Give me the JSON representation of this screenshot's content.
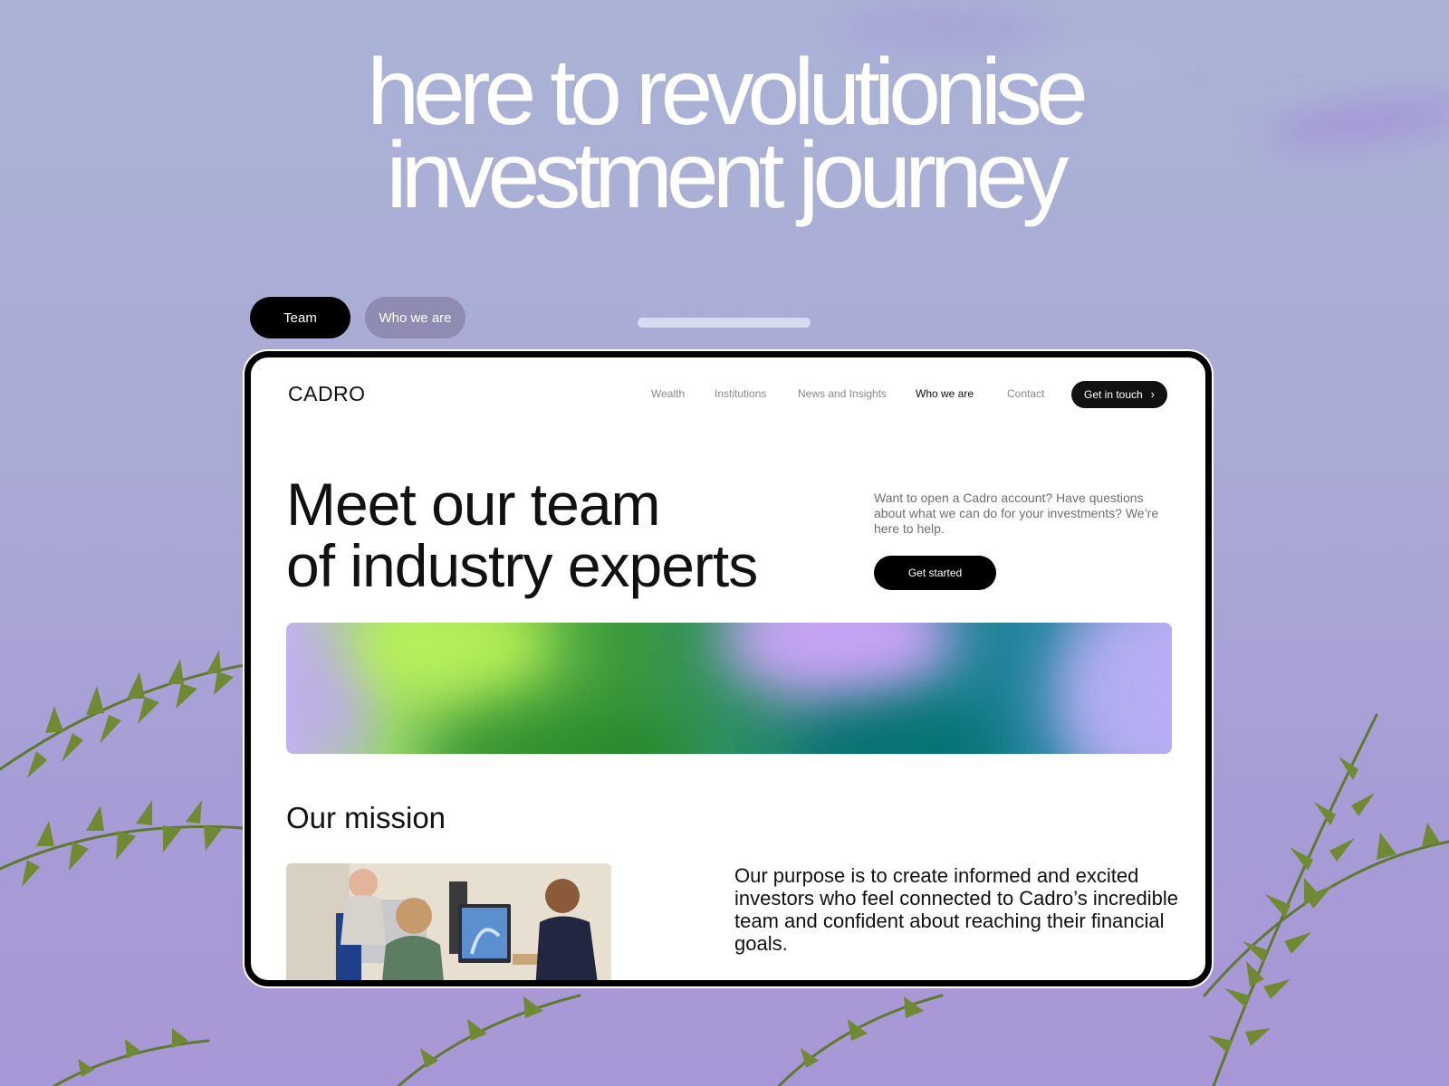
{
  "headline": {
    "line1": "here to revolutionise",
    "line2": "investment journey"
  },
  "tabs": [
    {
      "label": "Team",
      "active": true
    },
    {
      "label": "Who we are",
      "active": false
    }
  ],
  "site": {
    "logo": "CADRO",
    "nav": [
      {
        "label": "Wealth",
        "active": false
      },
      {
        "label": "Institutions",
        "active": false
      },
      {
        "label": "News and Insights",
        "active": false
      },
      {
        "label": "Who we are",
        "active": true
      },
      {
        "label": "Contact",
        "active": false
      }
    ],
    "cta_label": "Get in touch",
    "hero": {
      "title_line1": "Meet our team",
      "title_line2": "of industry experts",
      "text": "Want to open a Cadro account? Have questions about what we can do for your investments? We’re here to help.",
      "button_label": "Get started"
    },
    "mission": {
      "title": "Our mission",
      "text": "Our purpose is to create informed and excited investors who feel connected to Cadro’s incredible team and confident about reaching their financial goals."
    }
  },
  "colors": {
    "background": "#aaa9d6",
    "accent": "#000000",
    "nav_muted": "#8a8a8a"
  },
  "icons": {
    "cta_chevron": "chevron-right-icon"
  }
}
